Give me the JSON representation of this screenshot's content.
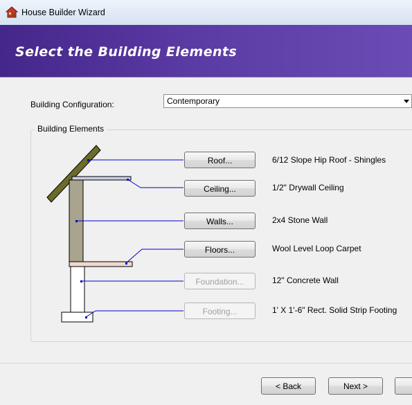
{
  "window": {
    "title": "House Builder Wizard"
  },
  "banner": {
    "title": "Select the Building Elements"
  },
  "config": {
    "label": "Building Configuration:",
    "value": "Contemporary"
  },
  "group": {
    "title": "Building Elements"
  },
  "elements": [
    {
      "button": "Roof...",
      "description": "6/12 Slope Hip Roof - Shingles",
      "enabled": true
    },
    {
      "button": "Ceiling...",
      "description": "1/2\" Drywall Ceiling",
      "enabled": true
    },
    {
      "button": "Walls...",
      "description": "2x4 Stone Wall",
      "enabled": true
    },
    {
      "button": "Floors...",
      "description": "Wool Level Loop Carpet",
      "enabled": true
    },
    {
      "button": "Foundation...",
      "description": "12\" Concrete Wall",
      "enabled": false
    },
    {
      "button": "Footing...",
      "description": "1' X 1'-6\" Rect. Solid Strip Footing",
      "enabled": false
    }
  ],
  "nav": {
    "back": "< Back",
    "next": "Next >"
  },
  "colors": {
    "banner": "#4a2c8f",
    "leader_line": "#0000cc",
    "roof": "#6b6b2a",
    "wall": "#a8a48d",
    "floor": "#f0d8cc"
  }
}
